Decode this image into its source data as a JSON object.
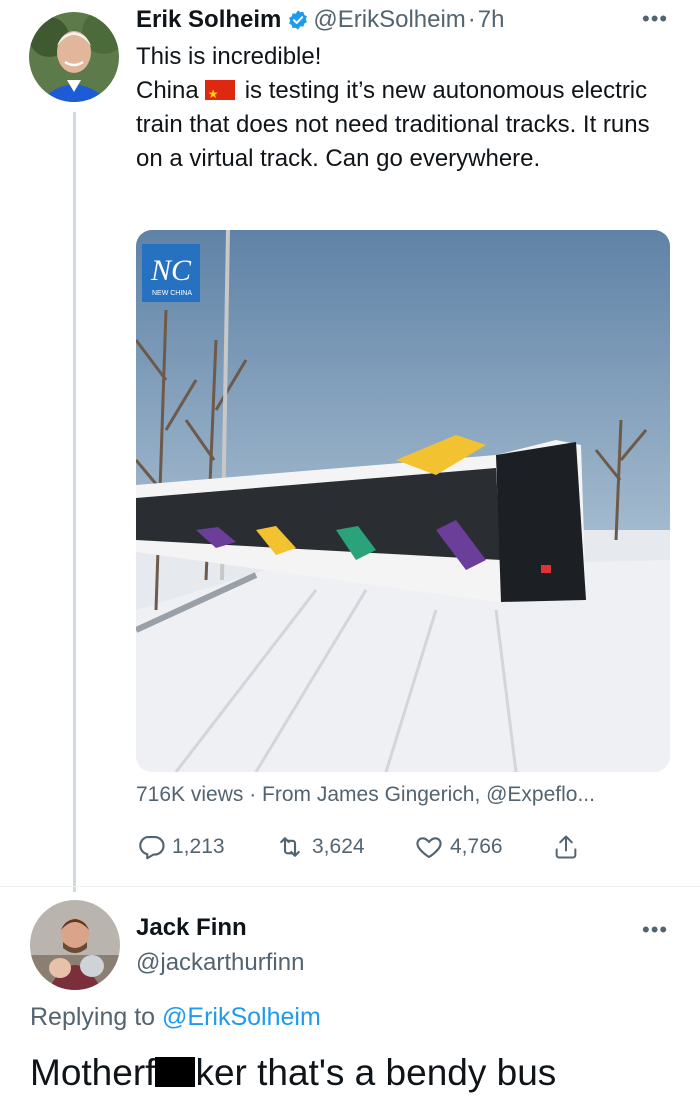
{
  "tweet": {
    "author_name": "Erik Solheim",
    "handle": "@ErikSolheim",
    "separator": "·",
    "time": "7h",
    "text_line1": "This is incredible!",
    "text_part_before_flag": "China",
    "flag_icon": "china-flag-emoji",
    "text_part_after_flag": "is testing it’s new autonomous electric train that does not need traditional tracks. It runs on a virtual track. Can go everywhere.",
    "media_watermark": "NEW CHINA",
    "views_text": "716K views · From James Gingerich, @Expeflo...",
    "reply_count": "1,213",
    "retweet_count": "3,624",
    "like_count": "4,766"
  },
  "reply": {
    "author_name": "Jack Finn",
    "handle": "@jackarthurfinn",
    "replying_to_label": "Replying to",
    "replying_to_handle": "@ErikSolheim",
    "text_before_censor": "Motherf",
    "text_after_censor": "ker that's a bendy bus"
  },
  "colors": {
    "link_blue": "#1d9bf0",
    "secondary_text": "#536471",
    "verified_badge": "#1d9bf0"
  }
}
